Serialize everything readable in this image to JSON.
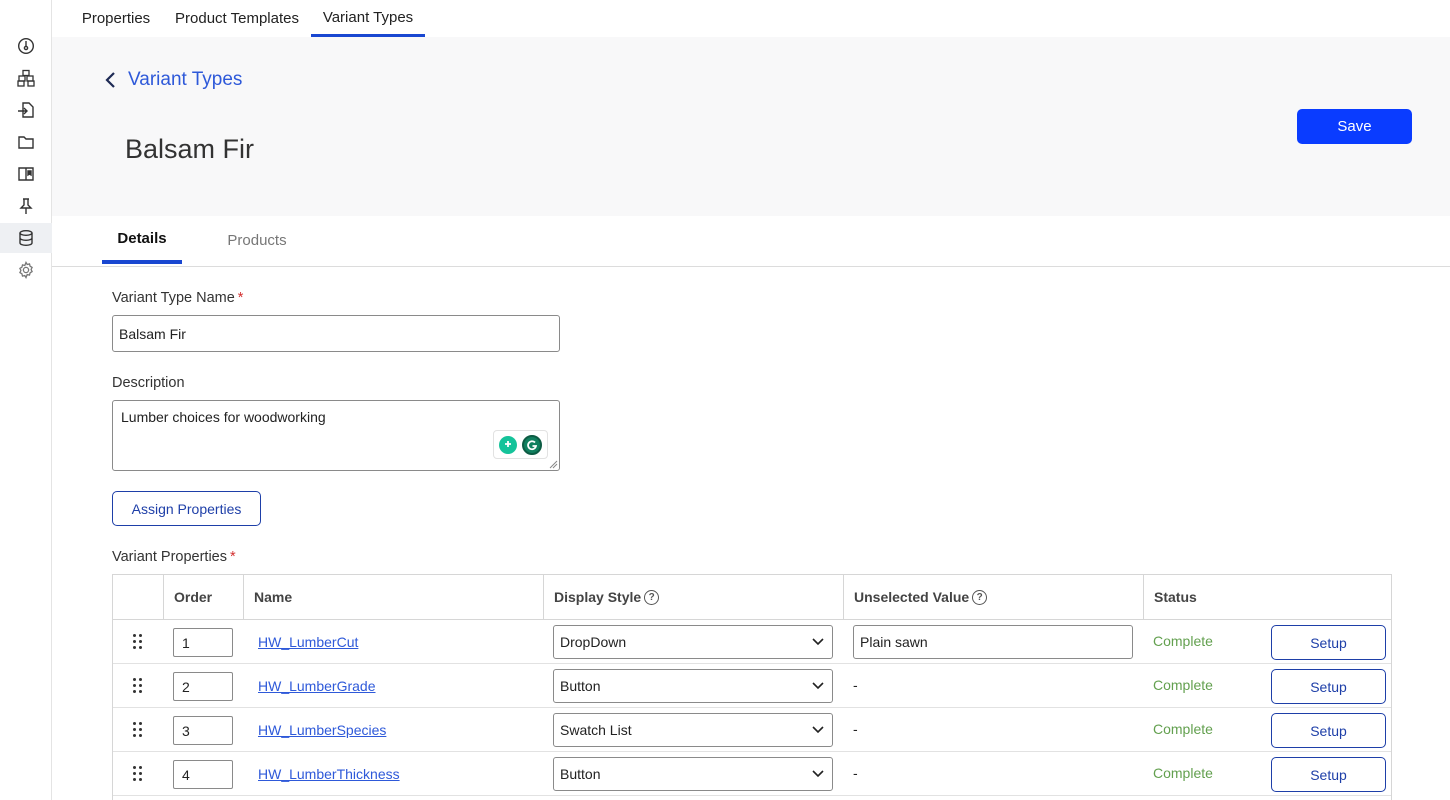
{
  "top_tabs": [
    {
      "label": "Properties"
    },
    {
      "label": "Product Templates"
    },
    {
      "label": "Variant Types"
    }
  ],
  "header": {
    "back_label": "Variant Types",
    "title": "Balsam Fir",
    "save_label": "Save"
  },
  "sub_tabs": [
    {
      "label": "Details"
    },
    {
      "label": "Products"
    }
  ],
  "form": {
    "name_label": "Variant Type Name",
    "name_value": "Balsam Fir",
    "description_label": "Description",
    "description_value": "Lumber choices for woodworking",
    "assign_label": "Assign Properties",
    "variant_props_label": "Variant Properties",
    "required_mark": "*"
  },
  "table": {
    "headers": {
      "order": "Order",
      "name": "Name",
      "display_style": "Display Style",
      "unselected_value": "Unselected Value",
      "status": "Status"
    },
    "help_glyph": "?",
    "rows": [
      {
        "order": "1",
        "name": "HW_LumberCut",
        "display_style": "DropDown",
        "unselected_value": "Plain sawn",
        "status": "Complete",
        "setup": "Setup"
      },
      {
        "order": "2",
        "name": "HW_LumberGrade",
        "display_style": "Button",
        "unselected_value": "-",
        "status": "Complete",
        "setup": "Setup"
      },
      {
        "order": "3",
        "name": "HW_LumberSpecies",
        "display_style": "Swatch List",
        "unselected_value": "-",
        "status": "Complete",
        "setup": "Setup"
      },
      {
        "order": "4",
        "name": "HW_LumberThickness",
        "display_style": "Button",
        "unselected_value": "-",
        "status": "Complete",
        "setup": "Setup"
      }
    ]
  },
  "sidebar_icons": [
    "dashboard-icon",
    "catalog-icon",
    "import-icon",
    "folder-icon",
    "library-icon",
    "pin-icon",
    "database-icon",
    "settings-icon"
  ],
  "colors": {
    "accent": "#1947d1",
    "primary_button": "#0a3cff",
    "link": "#2e59d9",
    "status_complete": "#63a04f",
    "required": "#d32f2f"
  }
}
